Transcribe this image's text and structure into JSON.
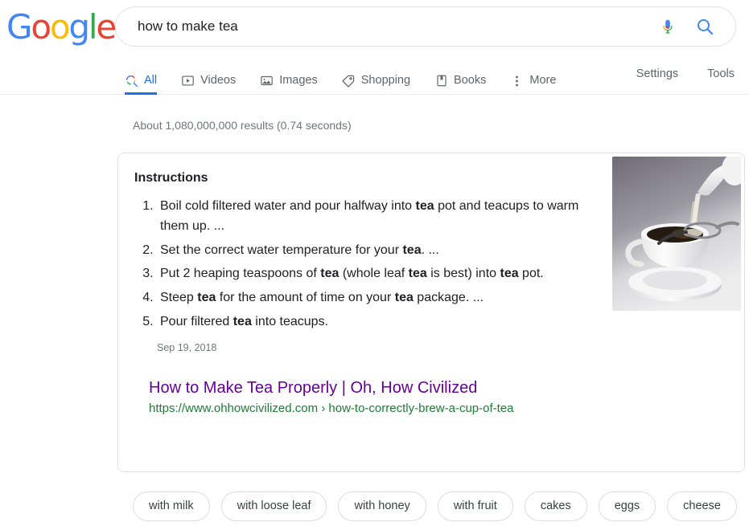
{
  "brand": {
    "logo_letters": [
      "G",
      "o",
      "o",
      "g",
      "l",
      "e"
    ],
    "colors": {
      "blue": "#4285F4",
      "red": "#EA4335",
      "yellow": "#FBBC05",
      "green": "#34A853",
      "link_blue": "#1a73e8",
      "visited_purple": "#660099",
      "url_green": "#1e7b36"
    }
  },
  "search": {
    "query": "how to make tea",
    "placeholder": "Search",
    "mic_icon": "microphone-icon",
    "search_icon": "search-icon"
  },
  "tabs": [
    {
      "label": "All",
      "icon": "search-colored-icon",
      "active": true
    },
    {
      "label": "Videos",
      "icon": "video-play-icon",
      "active": false
    },
    {
      "label": "Images",
      "icon": "image-icon",
      "active": false
    },
    {
      "label": "Shopping",
      "icon": "price-tag-icon",
      "active": false
    },
    {
      "label": "Books",
      "icon": "book-icon",
      "active": false
    },
    {
      "label": "More",
      "icon": "more-vertical-icon",
      "active": false
    }
  ],
  "tools": [
    {
      "label": "Settings"
    },
    {
      "label": "Tools"
    }
  ],
  "result_stats": "About 1,080,000,000 results (0.74 seconds)",
  "answer_card": {
    "heading": "Instructions",
    "steps": [
      {
        "html": "Boil cold filtered water and pour halfway into <b>tea</b> pot and teacups to warm them up. ..."
      },
      {
        "html": "Set the correct water temperature for your <b>tea</b>. ..."
      },
      {
        "html": "Put 2 heaping teaspoons of <b>tea</b> (whole leaf <b>tea</b> is best) into <b>tea</b> pot."
      },
      {
        "html": "Steep <b>tea</b> for the amount of time on your <b>tea</b> package. ..."
      },
      {
        "html": "Pour filtered <b>tea</b> into teacups."
      }
    ],
    "date": "Sep 19, 2018",
    "thumbnail_alt": "teacup-pour-thumbnail",
    "result": {
      "title": "How to Make Tea Properly | Oh, How Civilized",
      "url": "https://www.ohhowcivilized.com › how-to-correctly-brew-a-cup-of-tea"
    }
  },
  "related_chips": [
    {
      "label": "with milk"
    },
    {
      "label": "with loose leaf"
    },
    {
      "label": "with honey"
    },
    {
      "label": "with fruit"
    },
    {
      "label": "cakes"
    },
    {
      "label": "eggs"
    },
    {
      "label": "cheese"
    }
  ]
}
